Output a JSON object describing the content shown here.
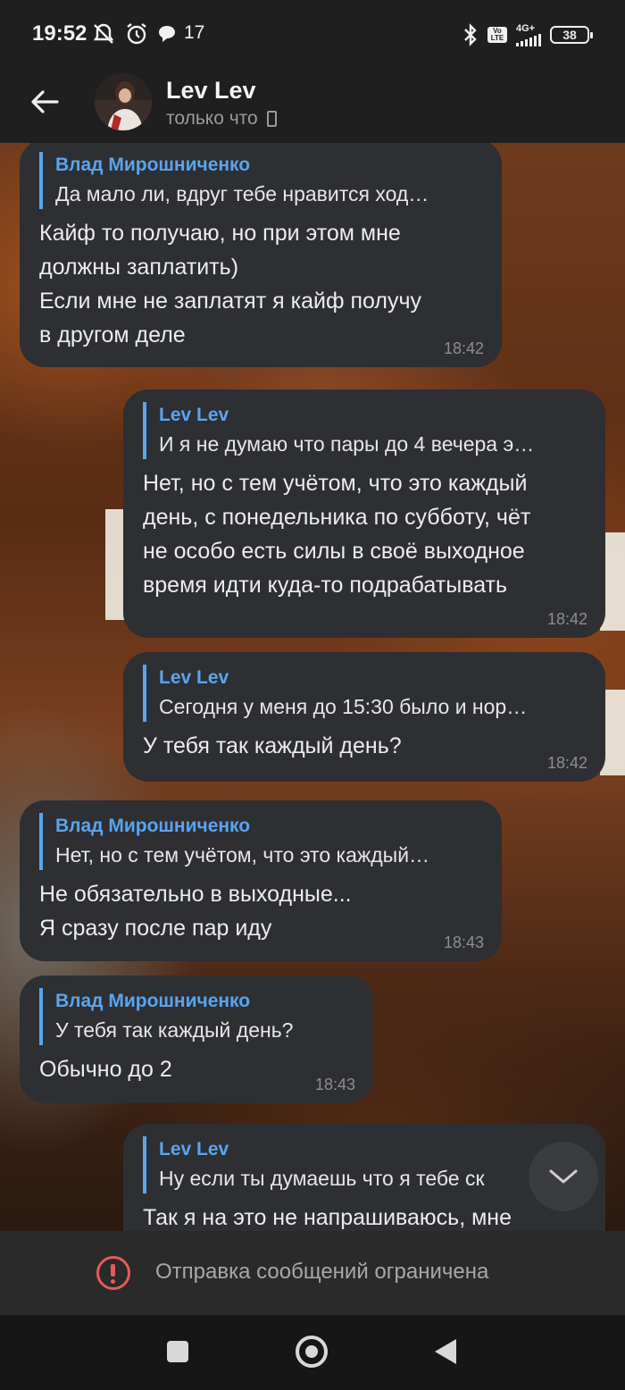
{
  "status_bar": {
    "time": "19:52",
    "notification_count": "17",
    "network": "4G+",
    "volte": "Vo LTE",
    "battery": "38",
    "icons": [
      "mute-icon",
      "alarm-icon",
      "chat-bubble-icon",
      "bluetooth-icon",
      "signal-icon",
      "battery-icon"
    ]
  },
  "header": {
    "name": "Lev Lev",
    "status": "только что",
    "icons": [
      "back-arrow-icon",
      "phone-device-icon"
    ]
  },
  "messages": [
    {
      "reply_name": "Влад Мирошниченко",
      "reply_text": "Да мало ли, вдруг тебе нравится ход…",
      "text": "Кайф то получаю, но при этом мне\nдолжны заплатить)\nЕсли мне не заплатят я кайф получу\nв другом деле",
      "time": "18:42"
    },
    {
      "reply_name": "Lev Lev",
      "reply_text": "И я не думаю что пары до 4 вечера э…",
      "text": "Нет, но с тем учётом, что это каждый\nдень, с понедельника по субботу, чёт\nне особо есть силы в своё выходное\nвремя идти куда-то подрабатывать",
      "time": "18:42"
    },
    {
      "reply_name": "Lev Lev",
      "reply_text": "Сегодня у меня до 15:30 было и нор…",
      "text": "У тебя так каждый день?",
      "time": "18:42"
    },
    {
      "reply_name": "Влад Мирошниченко",
      "reply_text": "Нет, но с тем учётом, что это каждый…",
      "text": "Не обязательно в выходные...\nЯ сразу после пар иду",
      "time": "18:43"
    },
    {
      "reply_name": "Влад Мирошниченко",
      "reply_text": "У тебя так каждый день?",
      "text": "Обычно до 2",
      "time": "18:43"
    },
    {
      "reply_name": "Lev Lev",
      "reply_text": "Ну если ты думаешь что я тебе ск",
      "text": "Так я на это не напрашиваюсь, мне"
    }
  ],
  "restriction": {
    "text": "Отправка сообщений ограничена"
  },
  "colors": {
    "bubble": "#2d2f33",
    "reply_accent": "#5aa4ee",
    "warning": "#e85a5a"
  }
}
